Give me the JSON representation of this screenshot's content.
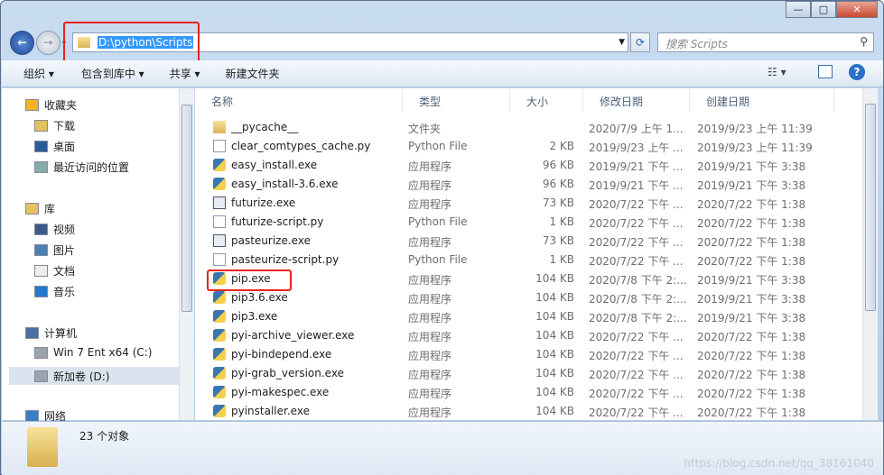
{
  "window": {
    "minimize": "—",
    "maximize": "□",
    "close": "✕"
  },
  "address": {
    "path": "D:\\python\\Scripts",
    "search_placeholder": "搜索 Scripts"
  },
  "toolbar": {
    "organize": "组织 ▾",
    "include_library": "包含到库中 ▾",
    "share": "共享 ▾",
    "new_folder": "新建文件夹"
  },
  "sidebar": {
    "items": [
      {
        "label": "收藏夹",
        "icon": "star-icon"
      },
      {
        "label": "下载",
        "icon": "download-folder-icon"
      },
      {
        "label": "桌面",
        "icon": "desktop-icon"
      },
      {
        "label": "最近访问的位置",
        "icon": "recent-places-icon"
      },
      {
        "label": "库",
        "icon": "library-icon"
      },
      {
        "label": "视频",
        "icon": "video-icon"
      },
      {
        "label": "图片",
        "icon": "pictures-icon"
      },
      {
        "label": "文档",
        "icon": "documents-icon"
      },
      {
        "label": "音乐",
        "icon": "music-icon"
      },
      {
        "label": "计算机",
        "icon": "computer-icon"
      },
      {
        "label": "Win 7 Ent x64 (C:)",
        "icon": "drive-icon"
      },
      {
        "label": "新加卷 (D:)",
        "icon": "drive-icon"
      },
      {
        "label": "网络",
        "icon": "network-icon"
      }
    ]
  },
  "columns": [
    "名称",
    "类型",
    "大小",
    "修改日期",
    "创建日期"
  ],
  "files": [
    {
      "name": "__pycache__",
      "type": "文件夹",
      "size": "",
      "modified": "2020/7/9 上午 1...",
      "created": "2019/9/23 上午 11:39",
      "icon": "folder"
    },
    {
      "name": "clear_comtypes_cache.py",
      "type": "Python File",
      "size": "2 KB",
      "modified": "2019/9/23 上午 ...",
      "created": "2019/9/23 上午 11:39",
      "icon": "py"
    },
    {
      "name": "easy_install.exe",
      "type": "应用程序",
      "size": "96 KB",
      "modified": "2019/9/21 下午 ...",
      "created": "2019/9/21 下午 3:38",
      "icon": "pyexe"
    },
    {
      "name": "easy_install-3.6.exe",
      "type": "应用程序",
      "size": "96 KB",
      "modified": "2019/9/21 下午 ...",
      "created": "2019/9/21 下午 3:38",
      "icon": "pyexe"
    },
    {
      "name": "futurize.exe",
      "type": "应用程序",
      "size": "73 KB",
      "modified": "2020/7/22 下午 ...",
      "created": "2020/7/22 下午 1:38",
      "icon": "exe"
    },
    {
      "name": "futurize-script.py",
      "type": "Python File",
      "size": "1 KB",
      "modified": "2020/7/22 下午 ...",
      "created": "2020/7/22 下午 1:38",
      "icon": "py"
    },
    {
      "name": "pasteurize.exe",
      "type": "应用程序",
      "size": "73 KB",
      "modified": "2020/7/22 下午 ...",
      "created": "2020/7/22 下午 1:38",
      "icon": "exe"
    },
    {
      "name": "pasteurize-script.py",
      "type": "Python File",
      "size": "1 KB",
      "modified": "2020/7/22 下午 ...",
      "created": "2020/7/22 下午 1:38",
      "icon": "py"
    },
    {
      "name": "pip.exe",
      "type": "应用程序",
      "size": "104 KB",
      "modified": "2020/7/8 下午 2:...",
      "created": "2019/9/21 下午 3:38",
      "icon": "pyexe"
    },
    {
      "name": "pip3.6.exe",
      "type": "应用程序",
      "size": "104 KB",
      "modified": "2020/7/8 下午 2:...",
      "created": "2019/9/21 下午 3:38",
      "icon": "pyexe"
    },
    {
      "name": "pip3.exe",
      "type": "应用程序",
      "size": "104 KB",
      "modified": "2020/7/8 下午 2:...",
      "created": "2019/9/21 下午 3:38",
      "icon": "pyexe"
    },
    {
      "name": "pyi-archive_viewer.exe",
      "type": "应用程序",
      "size": "104 KB",
      "modified": "2020/7/22 下午 ...",
      "created": "2020/7/22 下午 1:38",
      "icon": "pyexe"
    },
    {
      "name": "pyi-bindepend.exe",
      "type": "应用程序",
      "size": "104 KB",
      "modified": "2020/7/22 下午 ...",
      "created": "2020/7/22 下午 1:38",
      "icon": "pyexe"
    },
    {
      "name": "pyi-grab_version.exe",
      "type": "应用程序",
      "size": "104 KB",
      "modified": "2020/7/22 下午 ...",
      "created": "2020/7/22 下午 1:38",
      "icon": "pyexe"
    },
    {
      "name": "pyi-makespec.exe",
      "type": "应用程序",
      "size": "104 KB",
      "modified": "2020/7/22 下午 ...",
      "created": "2020/7/22 下午 1:38",
      "icon": "pyexe"
    },
    {
      "name": "pyinstaller.exe",
      "type": "应用程序",
      "size": "104 KB",
      "modified": "2020/7/22 下午 ...",
      "created": "2020/7/22 下午 1:38",
      "icon": "pyexe"
    }
  ],
  "status": {
    "count": "23 个对象"
  },
  "watermark": "https://blog.csdn.net/qq_38161040"
}
